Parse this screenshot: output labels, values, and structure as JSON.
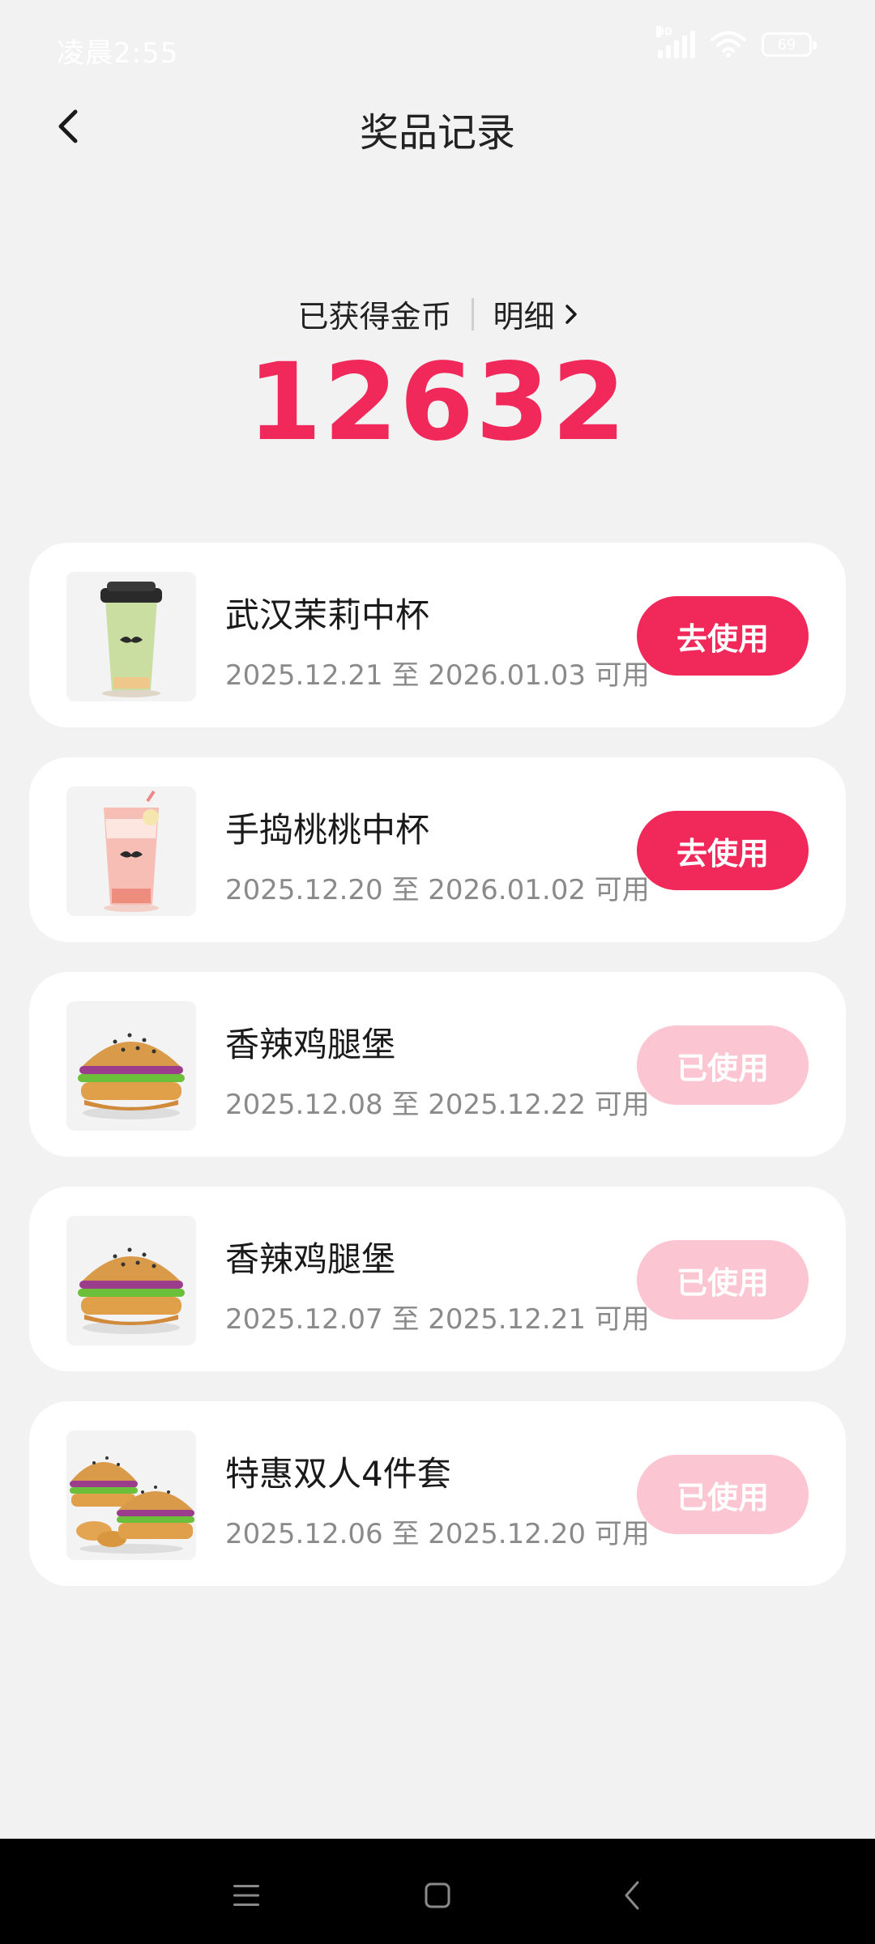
{
  "status_bar": {
    "time": "凌晨2:55",
    "hd": "HD",
    "battery": "69"
  },
  "header": {
    "title": "奖品记录"
  },
  "coins": {
    "label": "已获得金币",
    "detail_label": "明细",
    "value": "12632"
  },
  "colors": {
    "accent": "#f0295a",
    "used_button": "#fbc5d2",
    "background": "#f2f2f2",
    "card": "#ffffff"
  },
  "prizes": [
    {
      "name": "武汉茉莉中杯",
      "date": "2025.12.21 至 2026.01.03 可用",
      "button": "去使用",
      "status": "active",
      "icon": "jasmine-tea-cup-icon"
    },
    {
      "name": "手捣桃桃中杯",
      "date": "2025.12.20 至 2026.01.02 可用",
      "button": "去使用",
      "status": "active",
      "icon": "peach-drink-cup-icon"
    },
    {
      "name": "香辣鸡腿堡",
      "date": "2025.12.08 至 2025.12.22 可用",
      "button": "已使用",
      "status": "used",
      "icon": "chicken-burger-icon"
    },
    {
      "name": "香辣鸡腿堡",
      "date": "2025.12.07 至 2025.12.21 可用",
      "button": "已使用",
      "status": "used",
      "icon": "chicken-burger-icon"
    },
    {
      "name": "特惠双人4件套",
      "date": "2025.12.06 至 2025.12.20 可用",
      "button": "已使用",
      "status": "used",
      "icon": "burger-combo-icon"
    }
  ]
}
